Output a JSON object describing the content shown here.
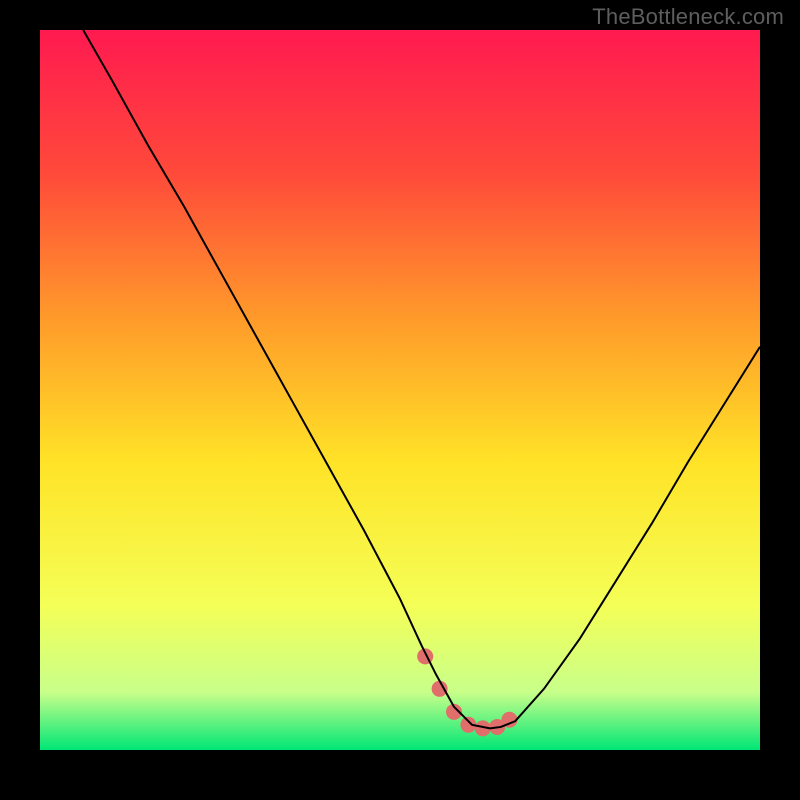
{
  "header": {
    "watermark": "TheBottleneck.com"
  },
  "chart_data": {
    "type": "line",
    "title": "",
    "xlabel": "",
    "ylabel": "",
    "xlim": [
      0,
      100
    ],
    "ylim": [
      0,
      100
    ],
    "background_gradient": {
      "stops": [
        {
          "offset": 0.0,
          "color": "#ff1a50"
        },
        {
          "offset": 0.2,
          "color": "#ff4a3a"
        },
        {
          "offset": 0.4,
          "color": "#ff9a2a"
        },
        {
          "offset": 0.6,
          "color": "#ffe327"
        },
        {
          "offset": 0.8,
          "color": "#f4ff57"
        },
        {
          "offset": 0.92,
          "color": "#c8ff8a"
        },
        {
          "offset": 1.0,
          "color": "#00e676"
        }
      ]
    },
    "curve": {
      "x": [
        6,
        10,
        15,
        20,
        25,
        30,
        35,
        40,
        45,
        50,
        53,
        55,
        57.5,
        60,
        62.5,
        64,
        66,
        70,
        75,
        80,
        85,
        90,
        95,
        100
      ],
      "y": [
        100,
        93,
        84,
        75.5,
        66.5,
        57.5,
        48.5,
        39.5,
        30.5,
        21,
        14.5,
        10.5,
        6,
        3.5,
        3,
        3.2,
        4,
        8.5,
        15.5,
        23.5,
        31.5,
        40,
        48,
        56
      ]
    },
    "marker_band": {
      "x": [
        53.5,
        55.5,
        57.5,
        59.5,
        61.5,
        63.5,
        65.2
      ],
      "y": [
        13.0,
        8.5,
        5.3,
        3.5,
        3.0,
        3.2,
        4.2
      ],
      "color": "#e06e6a",
      "radius_px": 8
    }
  }
}
